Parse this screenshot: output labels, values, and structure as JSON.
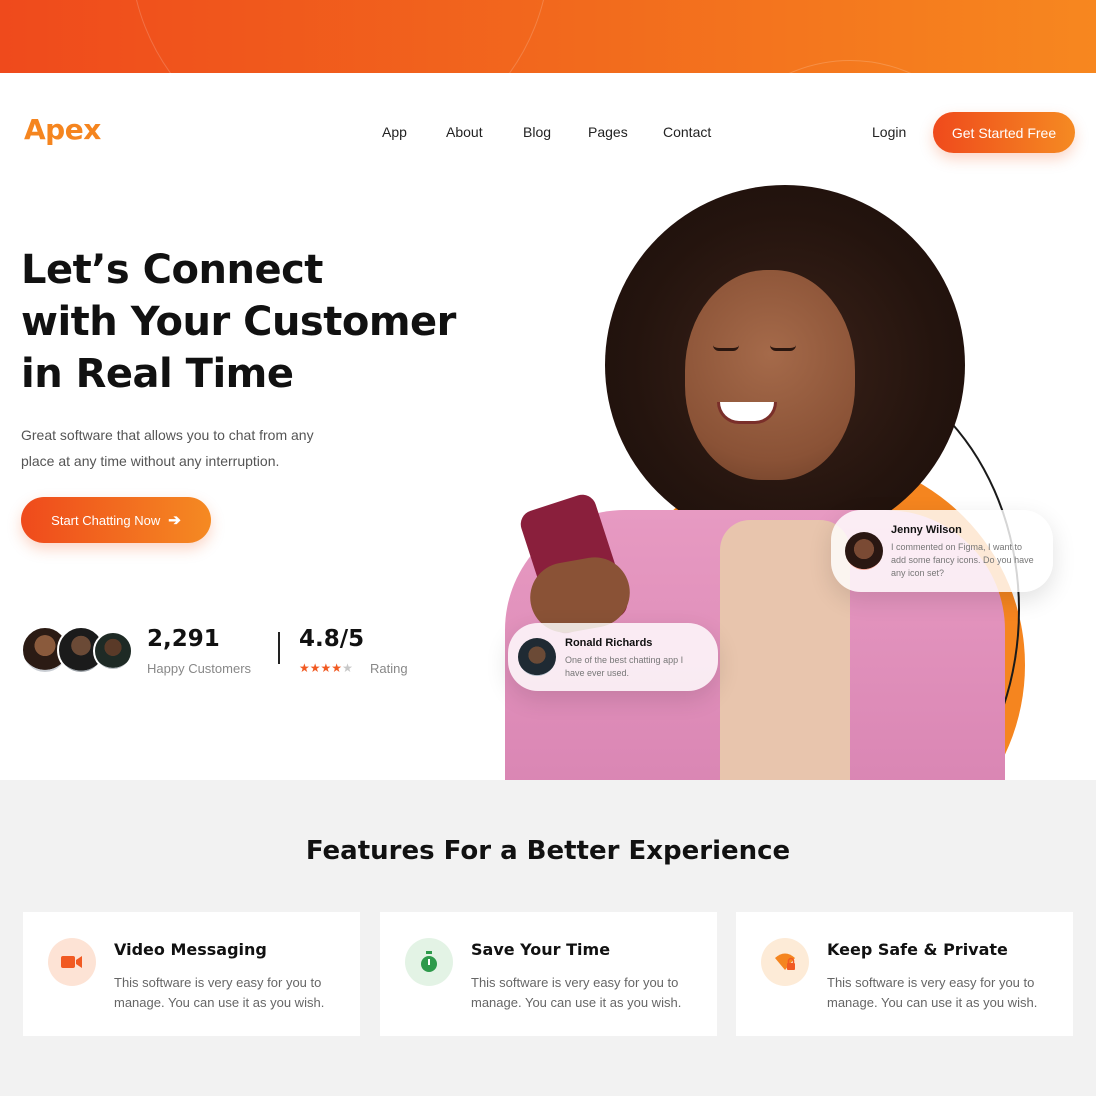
{
  "brand": {
    "logo": "Apex",
    "accent": "#f15a22",
    "accent_light": "#f5851f"
  },
  "nav": {
    "links": [
      "App",
      "About",
      "Blog",
      "Pages",
      "Contact"
    ],
    "login": "Login",
    "cta": "Get Started Free"
  },
  "hero": {
    "title_line1": "Let’s Connect",
    "title_line2": "with Your Customer",
    "title_line3": "in Real Time",
    "subtitle_line1": "Great software that allows you to chat from any",
    "subtitle_line2": "place at any time without any interruption.",
    "cta": "Start Chatting Now",
    "cta_icon": "arrow-right-icon"
  },
  "stats": {
    "customers_value": "2,291",
    "customers_label": "Happy Customers",
    "rating_value": "4.8/5",
    "rating_label": "Rating",
    "rating_stars_filled": 4,
    "rating_stars_total": 5
  },
  "chats": {
    "jenny": {
      "name": "Jenny Wilson",
      "message": "I commented on Figma, I want to add some fancy icons. Do you have any icon set?"
    },
    "ronald": {
      "name": "Ronald Richards",
      "message": "One of the best chatting app I have ever used."
    }
  },
  "features": {
    "title": "Features For a Better Experience",
    "cards": [
      {
        "title": "Video Messaging",
        "icon": "video-camera-icon",
        "desc": "This software is very easy for you to manage. You can use it as you wish."
      },
      {
        "title": "Save Your Time",
        "icon": "stopwatch-icon",
        "desc": "This software is very easy for you to manage. You can use it as you wish."
      },
      {
        "title": "Keep Safe & Private",
        "icon": "wifi-lock-icon",
        "desc": "This software is very easy for you to manage. You can use it as you wish."
      }
    ]
  }
}
